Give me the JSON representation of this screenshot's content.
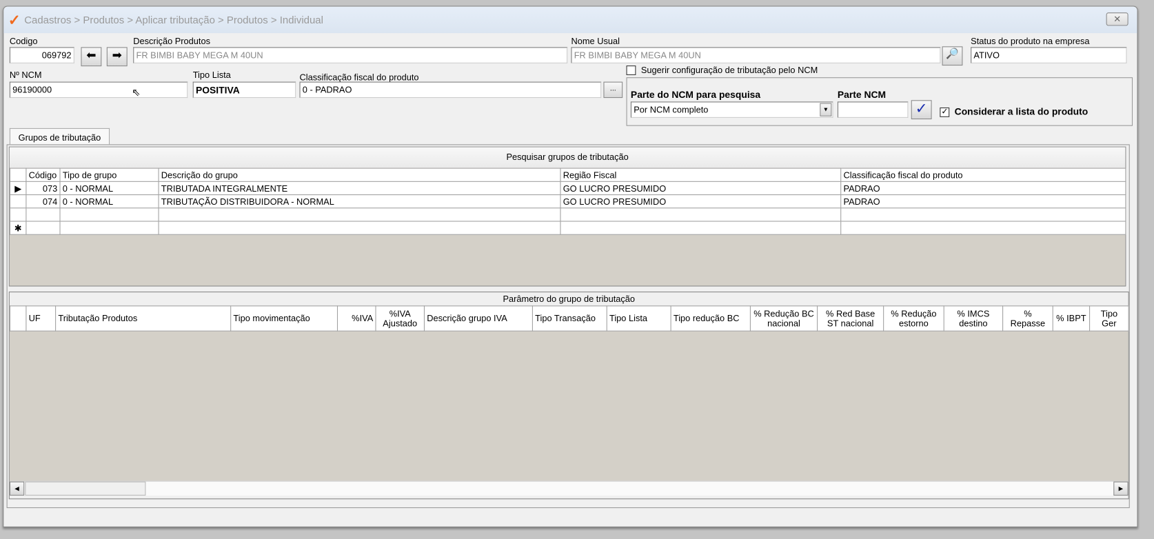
{
  "window": {
    "title": "Cadastros > Produtos > Aplicar tributação > Produtos > Individual",
    "close_icon": "close-icon"
  },
  "form": {
    "codigo_label": "Codigo",
    "codigo_value": "069792",
    "descricao_label": "Descrição  Produtos",
    "descricao_value": "FR BIMBI BABY MEGA M 40UN",
    "nome_usual_label": "Nome Usual",
    "nome_usual_value": "FR BIMBI BABY MEGA M 40UN",
    "status_label": "Status do produto na empresa",
    "status_value": "ATIVO",
    "ncm_label": "Nº NCM",
    "ncm_value": "96190000",
    "tipo_lista_label": "Tipo Lista",
    "tipo_lista_value": "POSITIVA",
    "classificacao_label": "Classificação fiscal do produto",
    "classificacao_value": "0 - PADRAO",
    "ellipsis_button": "...",
    "sugerir_label": "Sugerir configuração de tributação pelo NCM",
    "sugerir_checked": false,
    "parte_ncm_pesquisa_label": "Parte do NCM para pesquisa",
    "parte_ncm_pesquisa_value": "Por NCM completo",
    "parte_ncm_label": "Parte NCM",
    "parte_ncm_value": "",
    "considerar_label": "Considerar a lista do produto",
    "considerar_checked": true
  },
  "tabs": [
    {
      "label": "Grupos de tributação",
      "active": true
    }
  ],
  "grupos": {
    "search_button": "Pesquisar grupos de tributação",
    "columns": [
      "Código",
      "Tipo de grupo",
      "Descrição do grupo",
      "Região Fiscal",
      "Classificação fiscal do produto"
    ],
    "rows": [
      [
        "073",
        "0 - NORMAL",
        "TRIBUTADA INTEGRALMENTE",
        "GO LUCRO PRESUMIDO",
        "PADRAO"
      ],
      [
        "074",
        "0 - NORMAL",
        "TRIBUTAÇÃO DISTRIBUIDORA - NORMAL",
        "GO LUCRO PRESUMIDO",
        "PADRAO"
      ]
    ]
  },
  "parametros": {
    "title": "Parâmetro do grupo de tributação",
    "columns": [
      "UF",
      "Tributação Produtos",
      "Tipo movimentação",
      "%IVA",
      "%IVA Ajustado",
      "Descrição grupo IVA",
      "Tipo Transação",
      "Tipo Lista",
      "Tipo redução BC",
      "% Redução BC nacional",
      "% Red Base ST nacional",
      "% Redução estorno",
      "% IMCS destino",
      "% Repasse",
      "% IBPT",
      "Tipo Ger"
    ]
  }
}
